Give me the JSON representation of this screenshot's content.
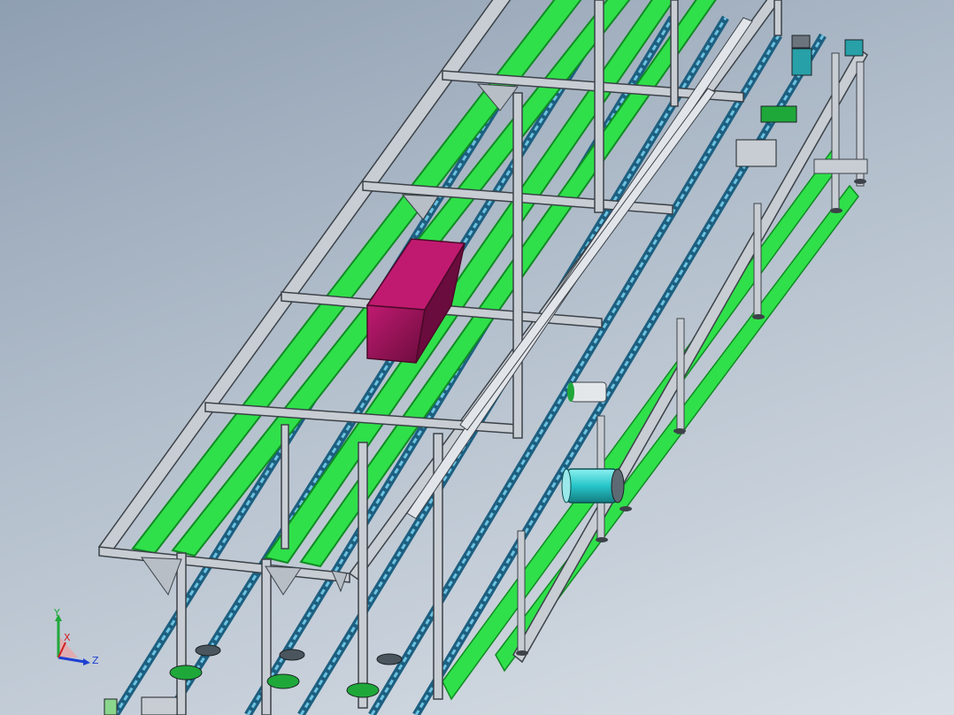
{
  "view": {
    "background_top": "#8f9fb2",
    "background_bottom": "#d9dfe6"
  },
  "model": {
    "description_tag": "conveyor-frame-assembly",
    "colors": {
      "frame_aluminum": "#c7cdd3",
      "frame_edge": "#3c4248",
      "guide_green": "#2fe04a",
      "guide_green_edge": "#118a24",
      "belt_blue": "#2f7fa8",
      "belt_blue_light": "#6cc2e0",
      "motor_cyan": "#27c6c9",
      "box_magenta": "#a3125e",
      "box_magenta_dark": "#6a0c3d"
    }
  },
  "triad": {
    "x_label": "X",
    "y_label": "Y",
    "z_label": "Z",
    "x_color": "#d21e1e",
    "y_color": "#1fa83a",
    "z_color": "#1f3fd2"
  }
}
